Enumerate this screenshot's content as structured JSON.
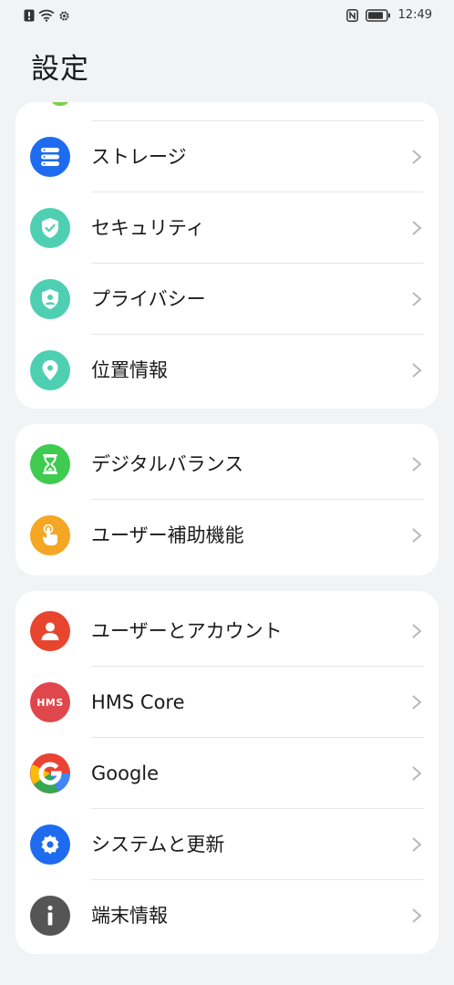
{
  "status_bar": {
    "time": "12:49"
  },
  "title": "設定",
  "groups": [
    {
      "rows": [
        {
          "label": "ストレージ",
          "icon": "storage-icon",
          "color": "#1f6bf0"
        },
        {
          "label": "セキュリティ",
          "icon": "security-shield-icon",
          "color": "#4fcfb2"
        },
        {
          "label": "プライバシー",
          "icon": "privacy-icon",
          "color": "#4fcfb2"
        },
        {
          "label": "位置情報",
          "icon": "location-pin-icon",
          "color": "#4fcfb2"
        }
      ]
    },
    {
      "rows": [
        {
          "label": "デジタルバランス",
          "icon": "hourglass-icon",
          "color": "#3ecb4f"
        },
        {
          "label": "ユーザー補助機能",
          "icon": "accessibility-hand-icon",
          "color": "#f5a623"
        }
      ]
    },
    {
      "rows": [
        {
          "label": "ユーザーとアカウント",
          "icon": "user-icon",
          "color": "#e8452f"
        },
        {
          "label": "HMS Core",
          "icon": "hms-icon",
          "color": "#e0474c",
          "icon_text": "HMS"
        },
        {
          "label": "Google",
          "icon": "google-icon",
          "color": "#ffffff"
        },
        {
          "label": "システムと更新",
          "icon": "system-gear-icon",
          "color": "#1f6bf0"
        },
        {
          "label": "端末情報",
          "icon": "info-icon",
          "color": "#555555"
        }
      ]
    }
  ]
}
